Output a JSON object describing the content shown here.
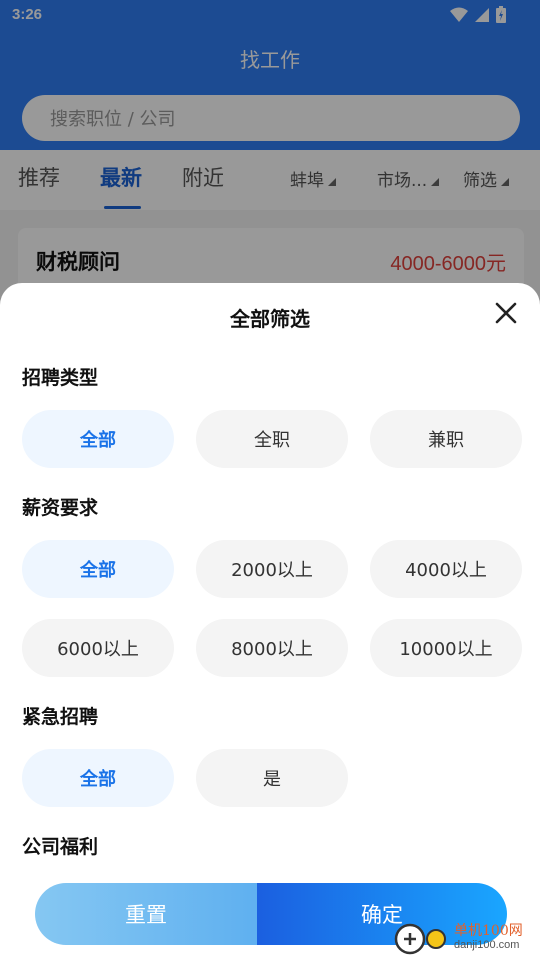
{
  "status": {
    "time": "3:26"
  },
  "header": {
    "title": "找工作",
    "search_placeholder": "搜索职位 / 公司"
  },
  "tabs": [
    {
      "label": "推荐"
    },
    {
      "label": "最新"
    },
    {
      "label": "附近"
    }
  ],
  "filters": [
    {
      "label": "蚌埠"
    },
    {
      "label": "市场..."
    },
    {
      "label": "筛选"
    }
  ],
  "job": {
    "title": "财税顾问",
    "salary": "4000-6000元"
  },
  "sheet": {
    "title": "全部筛选",
    "sections": {
      "type": {
        "title": "招聘类型",
        "options": [
          "全部",
          "全职",
          "兼职"
        ]
      },
      "salary": {
        "title": "薪资要求",
        "options": [
          "全部",
          "2000以上",
          "4000以上",
          "6000以上",
          "8000以上",
          "10000以上"
        ]
      },
      "urgent": {
        "title": "紧急招聘",
        "options": [
          "全部",
          "是"
        ]
      },
      "welfare": {
        "title": "公司福利"
      }
    },
    "reset_label": "重置",
    "confirm_label": "确定"
  },
  "watermark": {
    "name": "单机100网",
    "url": "danji100.com"
  },
  "colors": {
    "primary": "#2f7df4",
    "accent": "#1a73e8",
    "salary": "#e0413c"
  }
}
